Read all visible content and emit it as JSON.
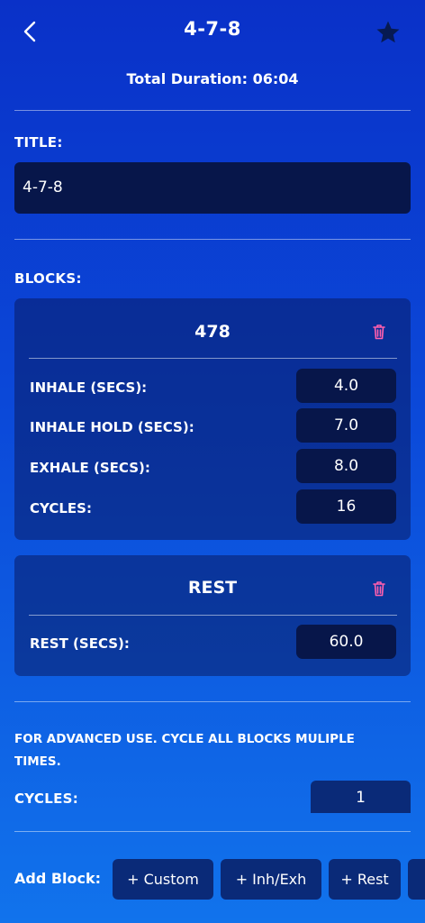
{
  "header": {
    "title": "4-7-8",
    "total_duration": "Total Duration: 06:04"
  },
  "title_section": {
    "label": "TITLE:",
    "value": "4-7-8"
  },
  "blocks_label": "BLOCKS:",
  "blocks": [
    {
      "name": "478",
      "rows": [
        {
          "label": "INHALE (SECS):",
          "value": "4.0"
        },
        {
          "label": "INHALE HOLD (SECS):",
          "value": "7.0"
        },
        {
          "label": "EXHALE (SECS):",
          "value": "8.0"
        },
        {
          "label": "CYCLES:",
          "value": "16"
        }
      ]
    },
    {
      "name": "REST",
      "rows": [
        {
          "label": "REST (SECS):",
          "value": "60.0"
        }
      ]
    }
  ],
  "advanced": {
    "text": "FOR ADVANCED USE. CYCLE ALL BLOCKS MULIPLE TIMES.",
    "cycles_label": "CYCLES:",
    "cycles_value": "1"
  },
  "add_block": {
    "label": "Add Block:",
    "buttons": [
      "+ Custom",
      "+ Inh/Exh",
      "+ Rest"
    ]
  },
  "colors": {
    "trash": "#ff5fae",
    "field_bg": "#07164a"
  }
}
